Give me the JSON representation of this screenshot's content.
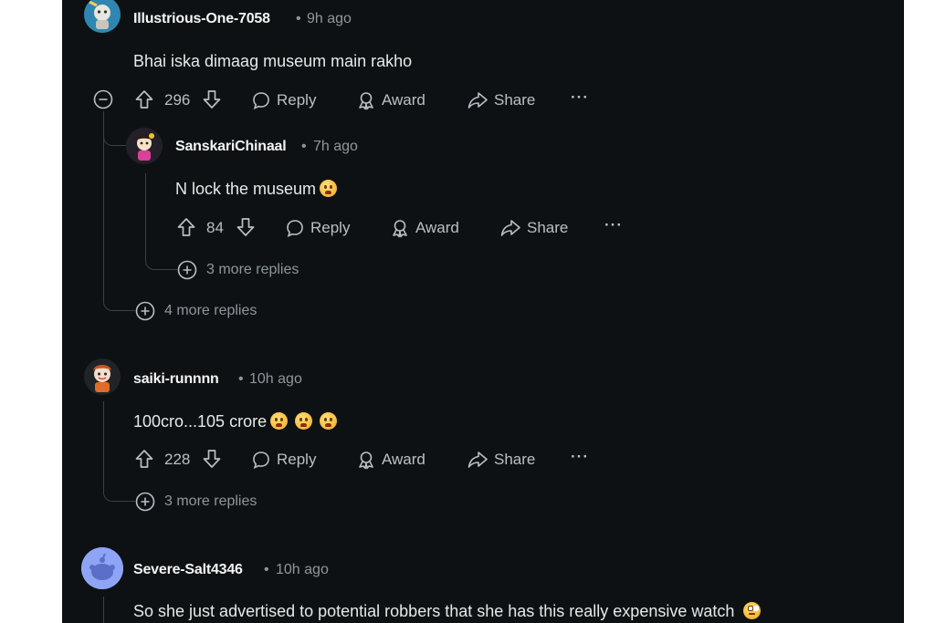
{
  "comments": [
    {
      "username": "Illustrious-One-7058",
      "time": "9h ago",
      "text": "Bhai iska dimaag museum main rakho",
      "votes": "296",
      "reply": "Reply",
      "award": "Award",
      "share": "Share"
    },
    {
      "username": "SanskariChinaal",
      "time": "7h ago",
      "text": "N lock the museum",
      "votes": "84",
      "reply": "Reply",
      "award": "Award",
      "share": "Share",
      "more_replies": "3 more replies"
    },
    {
      "username": "saiki-runnnn",
      "time": "10h ago",
      "text": "100cro...105 crore",
      "votes": "228",
      "reply": "Reply",
      "award": "Award",
      "share": "Share",
      "more_replies": "3 more replies"
    },
    {
      "username": "Severe-Salt4346",
      "time": "10h ago",
      "text": "So she just advertised to potential robbers that she has this really expensive watch"
    }
  ],
  "thread1_more_replies": "4 more replies",
  "separator": "•",
  "overflow_label": "···",
  "colors": {
    "background": "#0e1113",
    "text": "#e6e9ea",
    "muted": "#8d979c",
    "thread_line": "#3a4044"
  },
  "icons": [
    "upvote-icon",
    "downvote-icon",
    "reply-bubble-icon",
    "award-icon",
    "share-icon",
    "overflow-icon",
    "collapse-icon",
    "expand-icon"
  ]
}
